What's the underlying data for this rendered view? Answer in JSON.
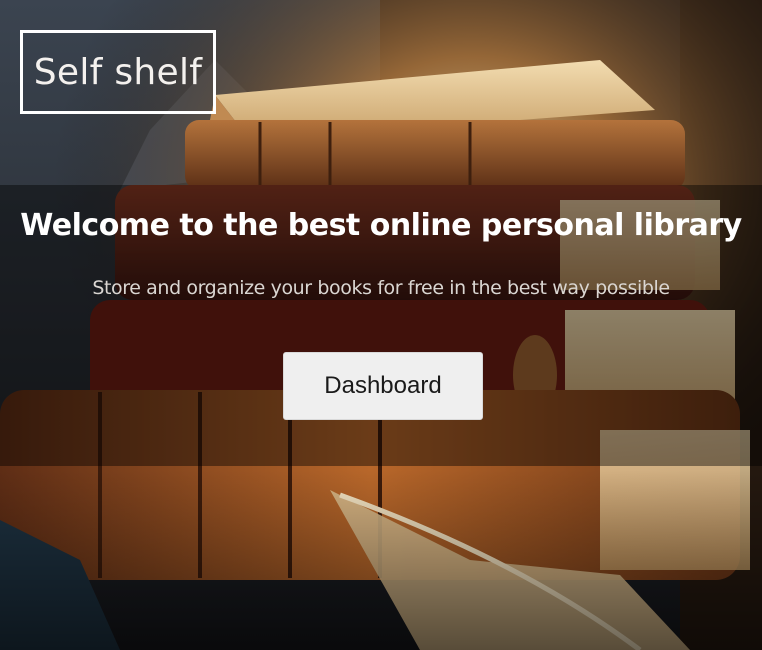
{
  "brand": {
    "logo_text": "Self shelf"
  },
  "hero": {
    "headline": "Welcome to the best online personal library",
    "subtitle": "Store and organize your books for free in the best way possible",
    "cta_label": "Dashboard"
  },
  "colors": {
    "overlay": "#000000",
    "button_bg": "#efefef",
    "text_primary": "#ffffff",
    "text_secondary": "#dad6d2"
  },
  "background": {
    "subject": "stack-of-antique-books-with-quill"
  }
}
